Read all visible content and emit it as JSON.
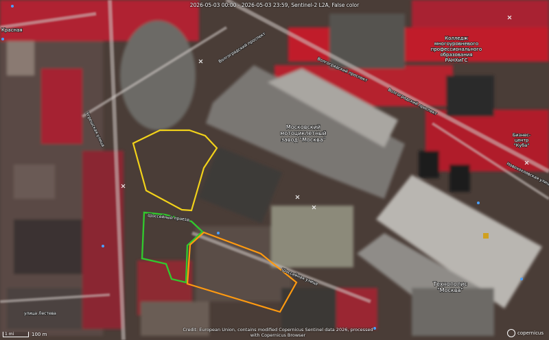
{
  "caption": "2026-05-03 00:00 - 2026-05-03 23:59, Sentinel-2 L2A, False color",
  "credit": "Credit: European Union, contains modified Copernicus Sentinel data 2026, processed with Copernicus Browser",
  "scale": {
    "label": "100 m",
    "box_text": "1 mi"
  },
  "logo_text": "copernicus",
  "colors": {
    "vegetation_red": "#c81f2b",
    "urban_gray": "#8f8c86",
    "poly_yellow": "#f2d21a",
    "poly_green": "#32c72e",
    "poly_orange": "#ff9a10"
  },
  "labels": {
    "plant": "Московский\nмотоциклетный\nзавод \"Москва\"",
    "college": "Колледж\nмногоуровневого\nпрофессионального\nобразования\nРАНХиГС",
    "tehnopolis": "Технополис\n\"Москва\"",
    "kuba": "Бизнес-\nцентр\n\"Куба\"",
    "krasnaya": "Красная",
    "street_1": "Волгоградский проспект",
    "street_2": "Волгоградский проспект",
    "street_3": "Шоссейный проезд",
    "street_4": "Волгоградский проспект",
    "street_5": "Новохохловская улица",
    "street_6": "Шоссейная улица",
    "street_7": "Угрешская улица",
    "street_8": "улица Лестева"
  }
}
